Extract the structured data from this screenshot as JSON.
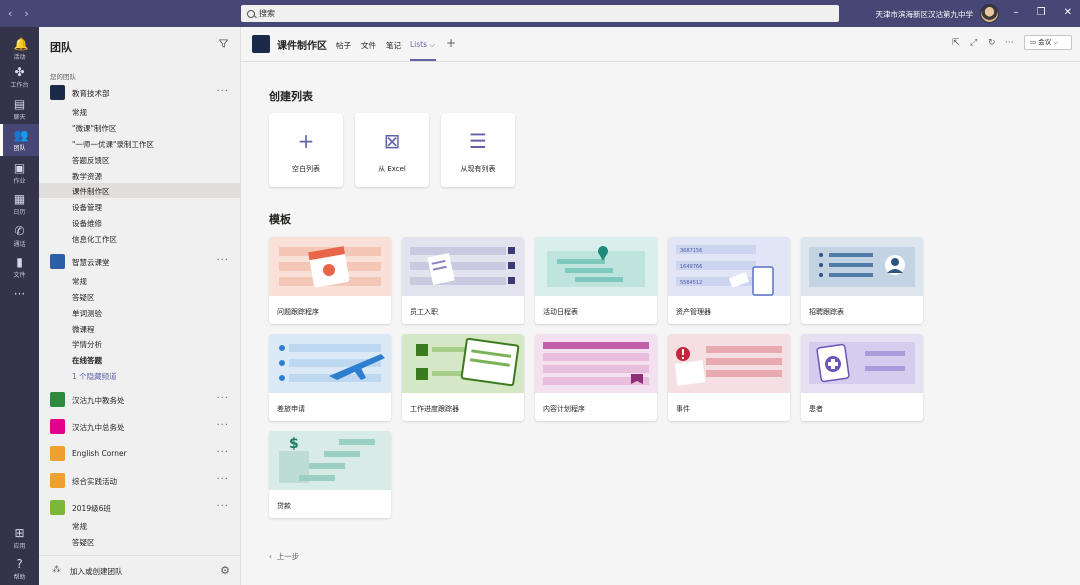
{
  "titlebar": {
    "search_placeholder": "搜索",
    "org_name": "天津市滨海新区汉沽第九中学",
    "minimize": "–",
    "restore": "❐",
    "close": "✕"
  },
  "appbar": [
    {
      "label": "活动",
      "icon": "bell-icon",
      "glyph": "🔔"
    },
    {
      "label": "工作台",
      "icon": "apps-icon",
      "glyph": "✤"
    },
    {
      "label": "聊天",
      "icon": "chat-icon",
      "glyph": "▤"
    },
    {
      "label": "团队",
      "icon": "teams-icon",
      "glyph": "👥"
    },
    {
      "label": "作业",
      "icon": "assignments-icon",
      "glyph": "▣"
    },
    {
      "label": "日历",
      "icon": "calendar-icon",
      "glyph": "▦"
    },
    {
      "label": "通话",
      "icon": "phone-icon",
      "glyph": "✆"
    },
    {
      "label": "文件",
      "icon": "files-icon",
      "glyph": "▮"
    },
    {
      "label": "",
      "icon": "more-apps-icon",
      "glyph": "···"
    },
    {
      "label": "应用",
      "icon": "store-icon",
      "glyph": "⊞"
    },
    {
      "label": "帮助",
      "icon": "help-icon",
      "glyph": "?"
    }
  ],
  "teampanel": {
    "header": "团队",
    "your_teams": "您的团队",
    "teams": [
      {
        "name": "教育技术部",
        "icon_color": "#1c2a4a",
        "channels": [
          "常规",
          "\"微课\"制作区",
          "\"一师一优课\"录制工作区",
          "答题反馈区",
          "教学资源",
          "课件制作区",
          "设备管理",
          "设备维修",
          "信息化工作区"
        ]
      },
      {
        "name": "智慧云课堂",
        "icon_color": "#2b5fa8",
        "channels": [
          "常规",
          "答疑区",
          "单词测验",
          "微课程",
          "学情分析",
          "在线答题"
        ],
        "hidden_link": "1 个隐藏频道"
      },
      {
        "name": "汉沽九中教务处",
        "icon_color": "#2e8b3e"
      },
      {
        "name": "汉沽九中总务处",
        "icon_color": "#e3008c"
      },
      {
        "name": "English Corner",
        "icon_color": "#f0a030"
      },
      {
        "name": "综合实践活动",
        "icon_color": "#f0a030"
      },
      {
        "name": "2019级6班",
        "icon_color": "#7bb83a",
        "channels": [
          "常规",
          "答疑区"
        ]
      }
    ],
    "footer": "加入或创建团队"
  },
  "channel": {
    "title": "课件制作区",
    "tabs": [
      "帖子",
      "文件",
      "笔记",
      "Lists ⌵"
    ],
    "add_tab": "+",
    "meet": "会议 ⌵"
  },
  "content": {
    "create_title": "创建列表",
    "create_options": [
      {
        "label": "空白列表",
        "icon": "plus-icon",
        "glyph": "+"
      },
      {
        "label": "从 Excel",
        "icon": "excel-icon",
        "glyph": "⊠"
      },
      {
        "label": "从现有列表",
        "icon": "list-icon",
        "glyph": "☰"
      }
    ],
    "templates_title": "模板",
    "templates": [
      {
        "label": "问题跟踪程序",
        "icon": "bug-icon",
        "bg": "#f9e0d8"
      },
      {
        "label": "员工入职",
        "icon": "document-icon",
        "bg": "#e3e3ef"
      },
      {
        "label": "活动日程表",
        "icon": "map-pin-icon",
        "bg": "#d8efec"
      },
      {
        "label": "资产管理器",
        "icon": "phone-device-icon",
        "bg": "#e1e5f6",
        "codes": [
          "3687156",
          "1649766",
          "5564512"
        ]
      },
      {
        "label": "招聘跟踪表",
        "icon": "person-icon",
        "bg": "#dde6ef"
      },
      {
        "label": "差旅申请",
        "icon": "airplane-icon",
        "bg": "#dbe9f7"
      },
      {
        "label": "工作进度跟踪器",
        "icon": "checklist-icon",
        "bg": "#d5e8c5"
      },
      {
        "label": "内容计划程序",
        "icon": "calendar-grid-icon",
        "bg": "#f4e1ef"
      },
      {
        "label": "事件",
        "icon": "alert-icon",
        "bg": "#f6dfe2"
      },
      {
        "label": "患者",
        "icon": "medical-icon",
        "bg": "#e5e1f3"
      },
      {
        "label": "贷款",
        "icon": "dollar-icon",
        "bg": "#d8ebe7"
      }
    ],
    "back": "上一步"
  }
}
